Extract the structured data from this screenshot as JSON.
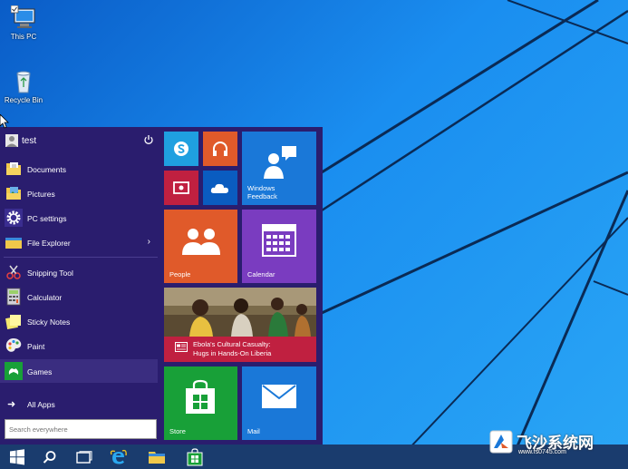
{
  "desktop": {
    "icons": [
      {
        "label": "This PC",
        "icon": "computer-icon"
      },
      {
        "label": "Recycle Bin",
        "icon": "recycle-bin-icon"
      }
    ]
  },
  "start_menu": {
    "user": {
      "name": "test",
      "power_icon": "power-icon"
    },
    "items": [
      {
        "label": "Documents",
        "icon": "folder-documents-icon"
      },
      {
        "label": "Pictures",
        "icon": "folder-pictures-icon"
      },
      {
        "label": "PC settings",
        "icon": "gear-icon"
      },
      {
        "label": "File Explorer",
        "icon": "file-explorer-icon",
        "has_submenu": true
      },
      {
        "label": "Snipping Tool",
        "icon": "scissors-icon"
      },
      {
        "label": "Calculator",
        "icon": "calculator-icon"
      },
      {
        "label": "Sticky Notes",
        "icon": "sticky-notes-icon"
      },
      {
        "label": "Paint",
        "icon": "palette-icon"
      },
      {
        "label": "Games",
        "icon": "xbox-icon",
        "selected": true
      }
    ],
    "all_apps": {
      "label": "All Apps",
      "icon": "arrow-right-icon"
    },
    "search": {
      "placeholder": "Search everywhere",
      "value": ""
    }
  },
  "tiles": {
    "skype": {
      "icon": "skype-icon",
      "color": "#1fa0e0"
    },
    "music": {
      "icon": "headphones-icon",
      "color": "#e05a2a"
    },
    "video": {
      "icon": "video-icon",
      "color": "#c02040"
    },
    "onedrive": {
      "icon": "cloud-icon",
      "color": "#0a5cc0"
    },
    "windows_feedback": {
      "label_line1": "Windows",
      "label_line2": "Feedback",
      "icon": "feedback-icon",
      "color": "#1a78d8"
    },
    "people": {
      "label": "People",
      "icon": "people-icon",
      "color": "#e05a2a"
    },
    "calendar": {
      "label": "Calendar",
      "icon": "calendar-icon",
      "color": "#7a3cc0"
    },
    "news": {
      "headline_line1": "Ebola's Cultural Casualty:",
      "headline_line2": "Hugs in Hands-On Liberia",
      "icon": "news-icon",
      "color": "#c02040"
    },
    "store": {
      "label": "Store",
      "icon": "store-bag-icon",
      "color": "#18a038"
    },
    "mail": {
      "label": "Mail",
      "icon": "mail-icon",
      "color": "#1a78d8"
    }
  },
  "taskbar": {
    "buttons": [
      {
        "icon": "windows-start-icon"
      },
      {
        "icon": "search-icon"
      },
      {
        "icon": "task-view-icon"
      },
      {
        "icon": "internet-explorer-icon"
      },
      {
        "icon": "file-explorer-icon"
      },
      {
        "icon": "store-icon"
      }
    ]
  },
  "watermark": {
    "text": "飞沙系统网",
    "url": "www.fs0745.com"
  }
}
